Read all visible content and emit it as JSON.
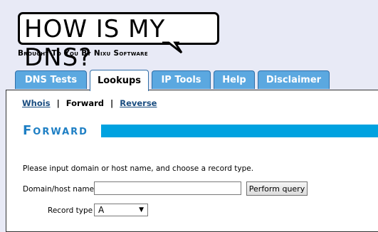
{
  "logo": {
    "title": "HOW IS MY DNS?",
    "tagline": "Brought To You By Nixu Software"
  },
  "tabs": [
    {
      "label": "DNS Tests",
      "active": false
    },
    {
      "label": "Lookups",
      "active": true
    },
    {
      "label": "IP Tools",
      "active": false
    },
    {
      "label": "Help",
      "active": false
    },
    {
      "label": "Disclaimer",
      "active": false
    }
  ],
  "subnav": {
    "whois": "Whois",
    "sep1": "|",
    "forward": "Forward",
    "sep2": "|",
    "reverse": "Reverse"
  },
  "section": {
    "title": "Forward",
    "accent_color": "#00a2e0"
  },
  "form": {
    "instructions": "Please input domain or host name, and choose a record type.",
    "domain_label": "Domain/host name",
    "domain_value": "",
    "submit_label": "Perform query",
    "record_label": "Record type",
    "record_value": "A",
    "record_icon": "chevron-down-icon"
  }
}
